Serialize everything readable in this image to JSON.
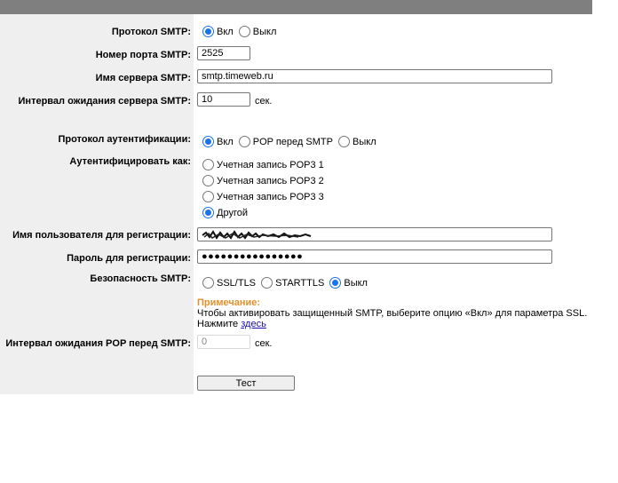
{
  "smtp": {
    "label": "Протокол SMTP:",
    "options": [
      {
        "label": "Вкл",
        "checked": true
      },
      {
        "label": "Выкл",
        "checked": false
      }
    ]
  },
  "port": {
    "label": "Номер порта SMTP:",
    "value": "2525"
  },
  "server": {
    "label": "Имя сервера SMTP:",
    "value": "smtp.timeweb.ru"
  },
  "timeout": {
    "label": "Интервал ожидания сервера SMTP:",
    "value": "10",
    "unit": "сек."
  },
  "auth": {
    "label": "Протокол аутентификации:",
    "options": [
      {
        "label": "Вкл",
        "checked": true
      },
      {
        "label": "POP перед SMTP",
        "checked": false
      },
      {
        "label": "Выкл",
        "checked": false
      }
    ]
  },
  "auth_as": {
    "label": "Аутентифицировать как:",
    "options": [
      {
        "label": "Учетная запись POP3 1",
        "checked": false
      },
      {
        "label": "Учетная запись POP3 2",
        "checked": false
      },
      {
        "label": "Учетная запись POP3 3",
        "checked": false
      },
      {
        "label": "Другой",
        "checked": true
      }
    ]
  },
  "username": {
    "label": "Имя пользователя для регистрации:"
  },
  "password": {
    "label": "Пароль для регистрации:",
    "value": "●●●●●●●●●●●●●●●●"
  },
  "security": {
    "label": "Безопасность SMTP:",
    "options": [
      {
        "label": "SSL/TLS",
        "checked": false
      },
      {
        "label": "STARTTLS",
        "checked": false
      },
      {
        "label": "Выкл",
        "checked": true
      }
    ]
  },
  "note": {
    "title": "Примечание:",
    "text": "Чтобы активировать защищенный SMTP, выберите опцию «Вкл» для параметра SSL.",
    "click_prefix": "Нажмите",
    "link": "здесь"
  },
  "pop_timeout": {
    "label": "Интервал ожидания POP перед SMTP:",
    "value": "0",
    "unit": "сек."
  },
  "test_button": "Тест",
  "colors": {
    "accent": "#1a73e8",
    "note": "#e0922e",
    "header": "#7f7f7f",
    "label_bg": "#efefef"
  }
}
